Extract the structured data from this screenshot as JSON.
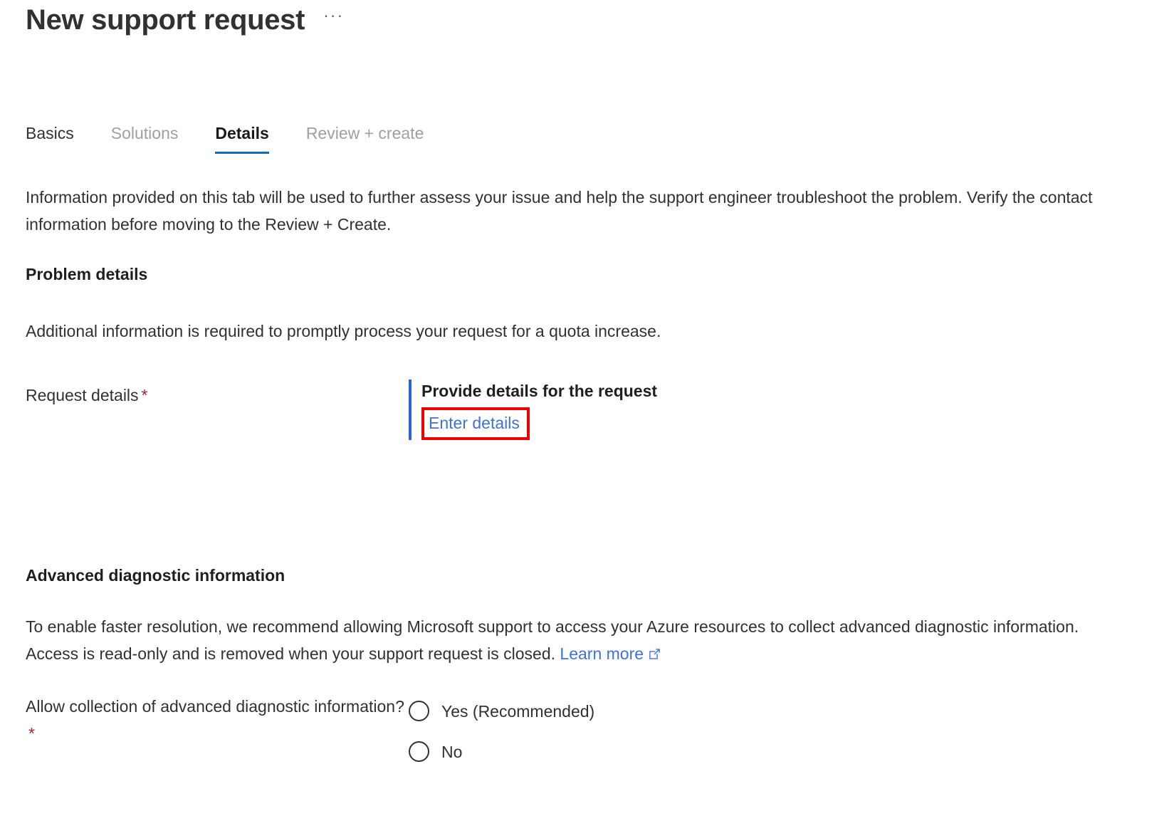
{
  "header": {
    "title": "New support request",
    "more_actions": "···"
  },
  "tabs": [
    {
      "label": "Basics",
      "state": "enabled"
    },
    {
      "label": "Solutions",
      "state": "disabled"
    },
    {
      "label": "Details",
      "state": "active"
    },
    {
      "label": "Review + create",
      "state": "disabled"
    }
  ],
  "intro_text": "Information provided on this tab will be used to further assess your issue and help the support engineer troubleshoot the problem. Verify the contact information before moving to the Review + Create.",
  "problem_details": {
    "heading": "Problem details",
    "description": "Additional information is required to promptly process your request for a quota increase.",
    "request_details": {
      "label": "Request details",
      "required_marker": "*",
      "control_title": "Provide details for the request",
      "link_label": "Enter details",
      "highlight_color": "#ec0000",
      "accent_bar_color": "#2a63e0",
      "link_color": "#3f71d8"
    }
  },
  "advanced_diagnostic": {
    "heading": "Advanced diagnostic information",
    "description_before_link": "To enable faster resolution, we recommend allowing Microsoft support to access your Azure resources to collect advanced diagnostic information. Access is read-only and is removed when your support request is closed. ",
    "learn_more_label": "Learn more",
    "question_label": "Allow collection of advanced diagnostic information?",
    "required_marker": "*",
    "options": [
      {
        "label": "Yes (Recommended)",
        "selected": false
      },
      {
        "label": "No",
        "selected": false
      }
    ]
  },
  "colors": {
    "accent": "#0f6cbd",
    "link": "#3f71d8",
    "required": "#a4262c",
    "highlight": "#ec0000",
    "text": "#323130",
    "muted": "#a19f9d"
  }
}
